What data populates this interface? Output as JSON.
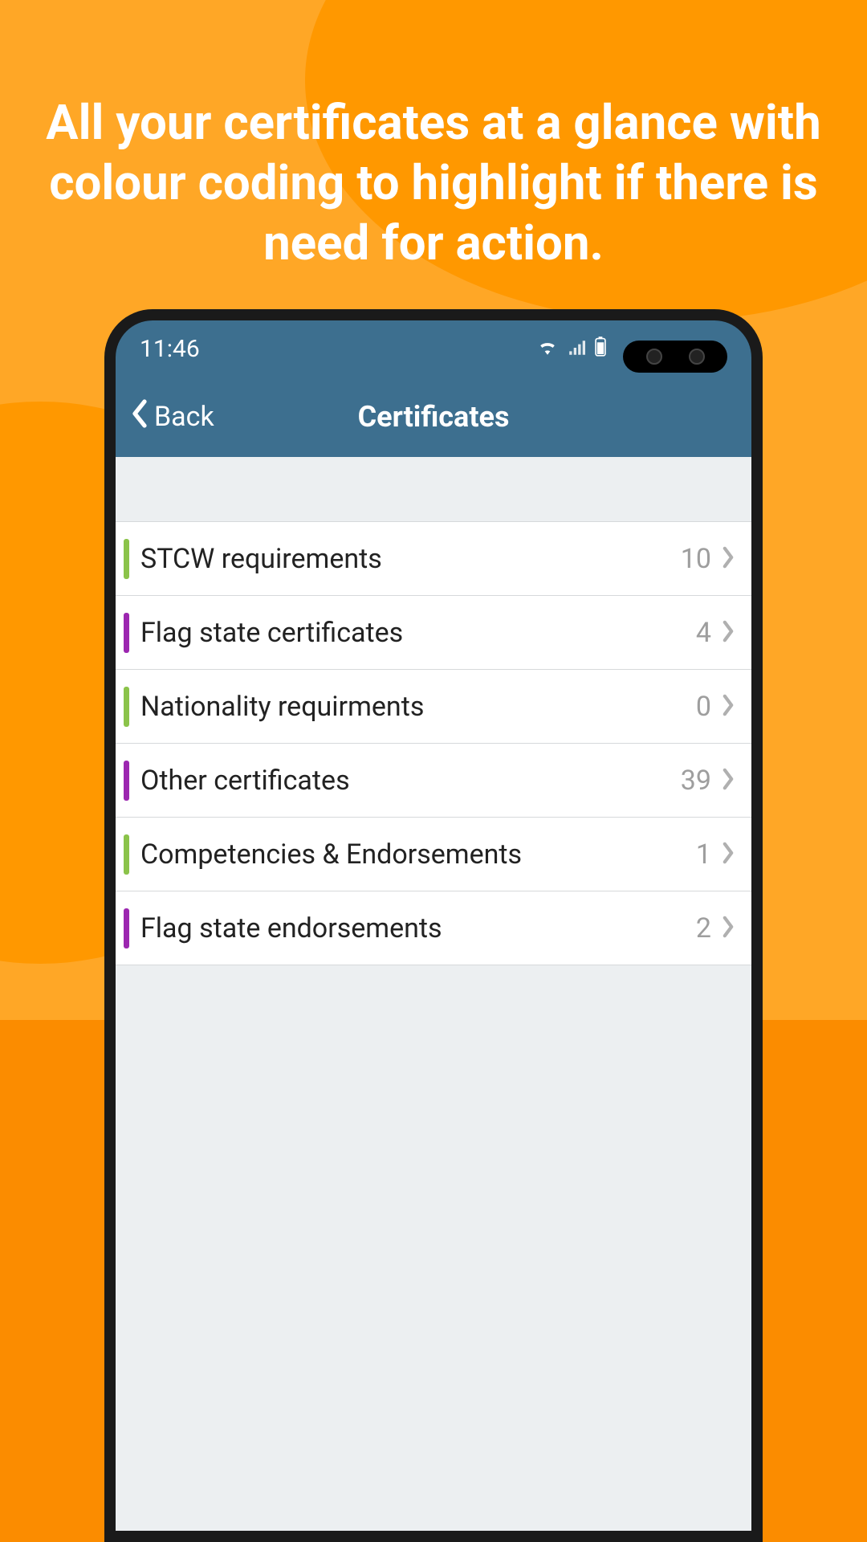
{
  "headline": "All your certificates at a glance with colour coding to highlight if there is need for action.",
  "status": {
    "time": "11:46"
  },
  "nav": {
    "back": "Back",
    "title": "Certificates"
  },
  "colors": {
    "green": "#8BC34A",
    "purple": "#9C27B0"
  },
  "rows": [
    {
      "label": "STCW requirements",
      "count": "10",
      "stripe": "green"
    },
    {
      "label": "Flag state certificates",
      "count": "4",
      "stripe": "purple"
    },
    {
      "label": "Nationality requirments",
      "count": "0",
      "stripe": "green"
    },
    {
      "label": "Other certificates",
      "count": "39",
      "stripe": "purple"
    },
    {
      "label": "Competencies & Endorsements",
      "count": "1",
      "stripe": "green"
    },
    {
      "label": "Flag state endorsements",
      "count": "2",
      "stripe": "purple"
    }
  ]
}
